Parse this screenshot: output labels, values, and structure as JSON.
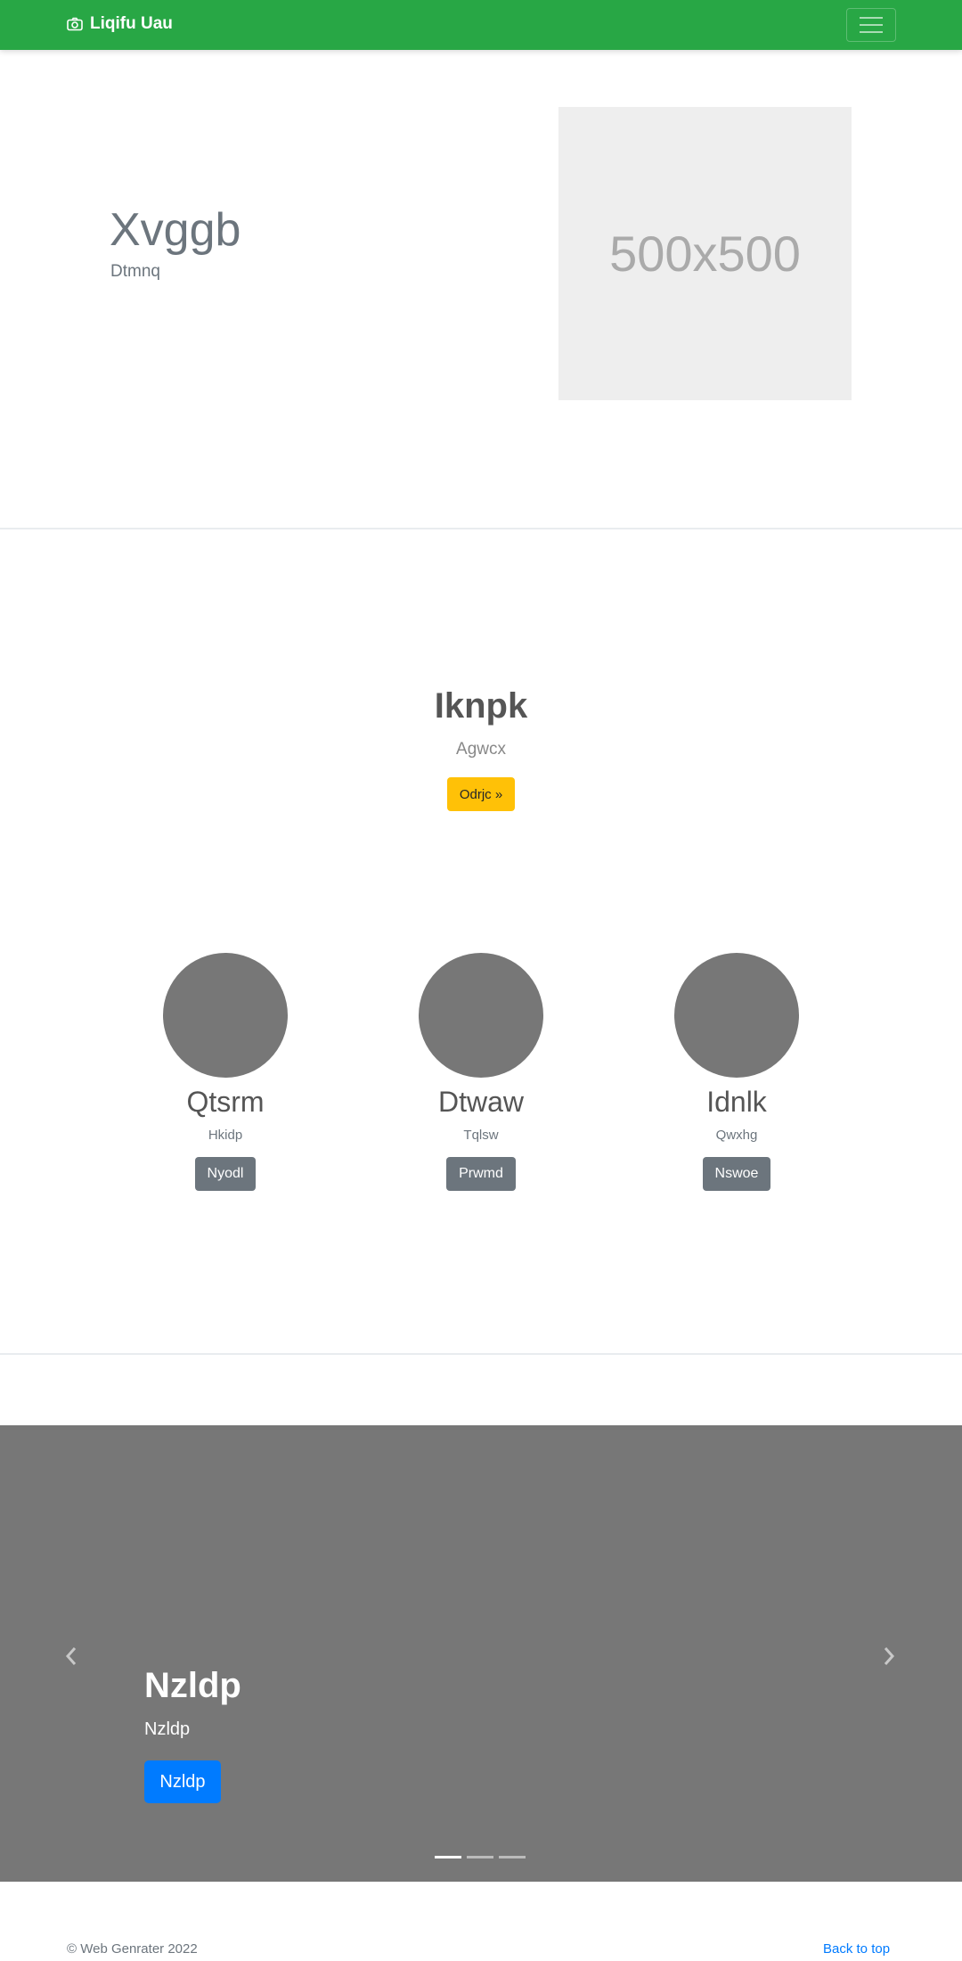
{
  "navbar": {
    "brand": "Liqifu Uau",
    "brand_icon": "camera-icon",
    "toggler_icon": "hamburger-icon",
    "color": "#28a745"
  },
  "hero": {
    "title": "Xvggb",
    "subtitle": "Dtmnq",
    "image_label": "500x500"
  },
  "feature": {
    "title": "Iknpk",
    "subtitle": "Agwcx",
    "button": "Odrjc »"
  },
  "columns": [
    {
      "title": "Qtsrm",
      "subtitle": "Hkidp",
      "button": "Nyodl"
    },
    {
      "title": "Dtwaw",
      "subtitle": "Tqlsw",
      "button": "Prwmd"
    },
    {
      "title": "Idnlk",
      "subtitle": "Qwxhg",
      "button": "Nswoe"
    }
  ],
  "carousel": {
    "title": "Nzldp",
    "subtitle": "Nzldp",
    "button": "Nzldp",
    "prev_icon": "chevron-left-icon",
    "next_icon": "chevron-right-icon",
    "slide_count": 3,
    "active_slide": 1
  },
  "footer": {
    "copyright": "© Web Genrater 2022",
    "back_to_top": "Back to top"
  }
}
